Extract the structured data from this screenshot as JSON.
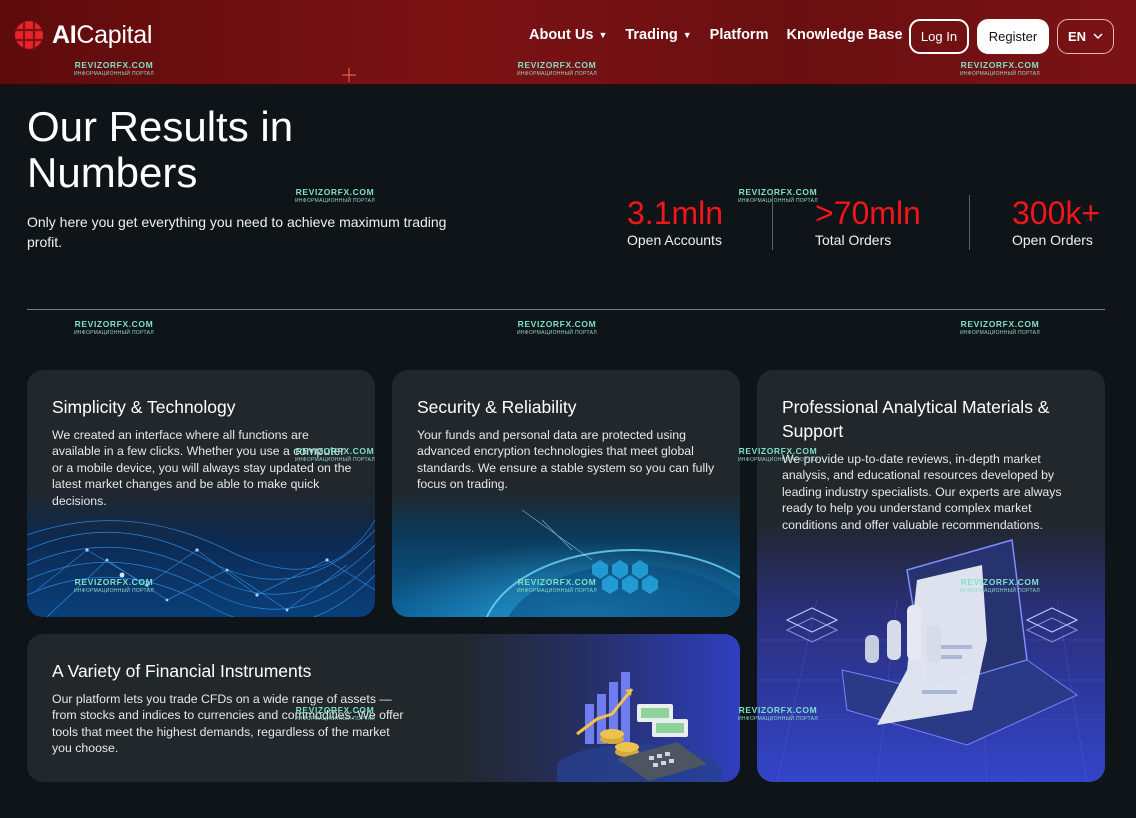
{
  "header": {
    "logo": {
      "bold": "AI",
      "light": "Capital"
    },
    "nav": [
      {
        "label": "About Us",
        "dropdown": true
      },
      {
        "label": "Trading",
        "dropdown": true
      },
      {
        "label": "Platform",
        "dropdown": false
      },
      {
        "label": "Knowledge Base",
        "dropdown": false
      }
    ],
    "login_label": "Log In",
    "register_label": "Register",
    "language": "EN"
  },
  "watermark": {
    "text": "REVIZORFX.COM",
    "subtext": "ИНФОРМАЦИОННЫЙ ПОРТАЛ"
  },
  "hero": {
    "title_line1": "Our Results in",
    "title_line2": "Numbers",
    "subtitle": "Only here you get everything you need to achieve maximum trading profit."
  },
  "stats": [
    {
      "value": "3.1mln",
      "label": "Open Accounts"
    },
    {
      "value": ">70mln",
      "label": "Total Orders"
    },
    {
      "value": "300k+",
      "label": "Open Orders"
    }
  ],
  "cards": [
    {
      "title": "Simplicity & Technology",
      "text": "We created an interface where all functions are available in a few clicks. Whether you use a computer or a mobile device, you will always stay updated on the latest market changes and be able to make quick decisions."
    },
    {
      "title": "Security & Reliability",
      "text": "Your funds and personal data are protected using advanced encryption technologies that meet global standards. We ensure a stable system so you can fully focus on trading."
    },
    {
      "title": "Professional Analytical Materials & Support",
      "text": "We provide up-to-date reviews, in-depth market analysis, and educational resources developed by leading industry specialists. Our experts are always ready to help you understand complex market conditions and offer valuable recommendations."
    },
    {
      "title": "A Variety of Financial Instruments",
      "text": "Our platform lets you trade CFDs on a wide range of assets — from stocks and indices to currencies and commodities. We offer tools that meet the highest demands, regardless of the market you choose."
    }
  ],
  "colors": {
    "accent": "#f2151a",
    "header_bg": "#7c1214",
    "page_bg": "#0e1417",
    "card_bg": "#21272b"
  }
}
